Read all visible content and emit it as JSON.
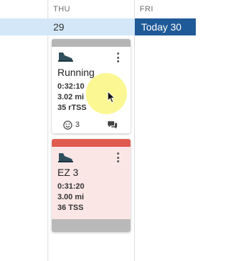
{
  "calendar": {
    "days": [
      {
        "name": "THU",
        "date": "29"
      },
      {
        "name": "FRI",
        "date": "Today 30"
      }
    ],
    "colors": {
      "date_band": "#d3e7f8",
      "today": "#1f5a98"
    }
  },
  "workouts": [
    {
      "sport_icon": "running-shoe-icon",
      "title": "Running",
      "duration": "0:32:10",
      "distance": "3.02 mi",
      "stress": "35 rTSS",
      "smiley_count": "3",
      "status_color": "#b5b5b5"
    },
    {
      "sport_icon": "running-shoe-icon",
      "title": "EZ 3",
      "duration": "0:31:20",
      "distance": "3.00 mi",
      "stress": "36 TSS",
      "status_color": "#e05a4f"
    }
  ]
}
